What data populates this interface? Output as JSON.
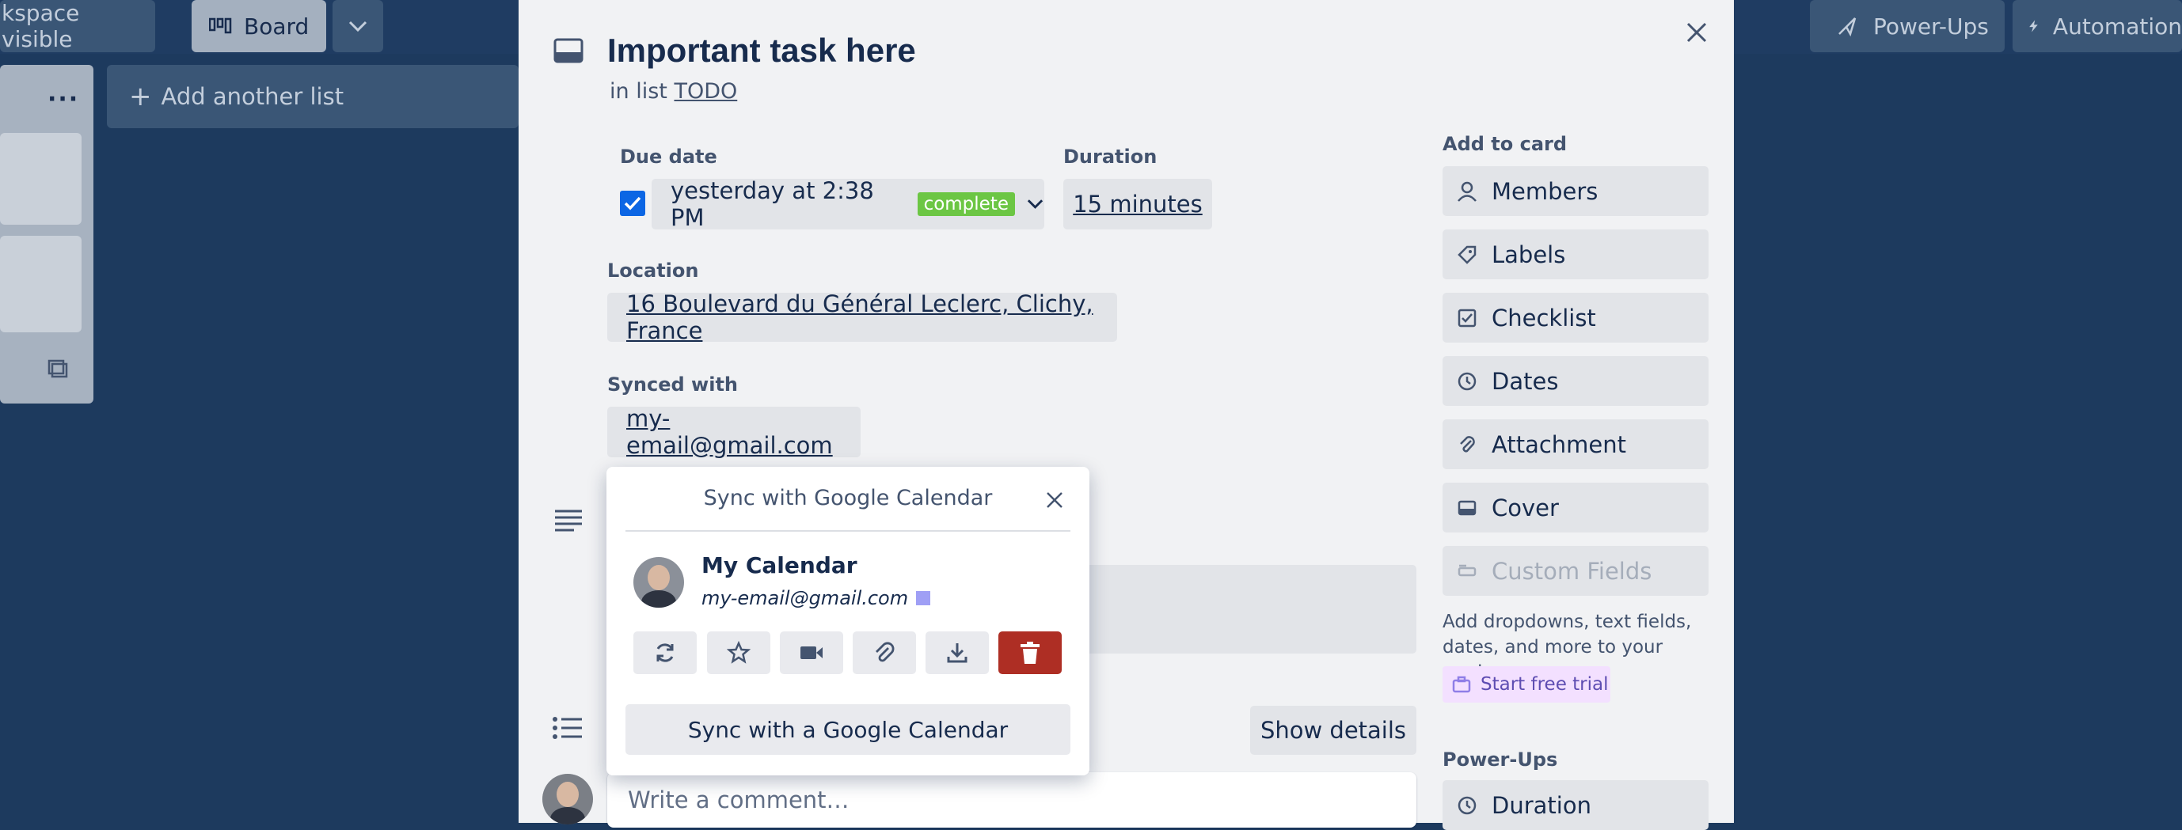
{
  "board": {
    "visibility_label": "kspace visible",
    "view_label": "Board",
    "powerups_label": "Power-Ups",
    "automation_label": "Automation",
    "add_list_label": "Add another list"
  },
  "card": {
    "title": "Important task here",
    "in_list_prefix": "in list",
    "list_name": "TODO",
    "due_date": {
      "label": "Due date",
      "value": "yesterday at 2:38 PM",
      "badge": "complete",
      "checked": true
    },
    "duration": {
      "label": "Duration",
      "value": "15 minutes"
    },
    "location": {
      "label": "Location",
      "value": "16 Boulevard du Général Leclerc, Clichy, France"
    },
    "synced": {
      "label": "Synced with",
      "value": "my-email@gmail.com"
    },
    "show_details_label": "Show details",
    "comment_placeholder": "Write a comment…"
  },
  "sidebar": {
    "add_to_card_label": "Add to card",
    "items": [
      {
        "label": "Members",
        "icon": "person-icon"
      },
      {
        "label": "Labels",
        "icon": "tag-icon"
      },
      {
        "label": "Checklist",
        "icon": "checklist-icon"
      },
      {
        "label": "Dates",
        "icon": "clock-icon"
      },
      {
        "label": "Attachment",
        "icon": "paperclip-icon"
      },
      {
        "label": "Cover",
        "icon": "cover-icon"
      },
      {
        "label": "Custom Fields",
        "icon": "custom-fields-icon",
        "disabled": true
      }
    ],
    "custom_fields_hint": "Add dropdowns, text fields, dates, and more to your cards.",
    "trial_label": "Start free trial",
    "powerups_label": "Power-Ups",
    "powerups_items": [
      {
        "label": "Duration",
        "icon": "clock-icon"
      }
    ]
  },
  "popover": {
    "title": "Sync with Google Calendar",
    "calendar_name": "My Calendar",
    "calendar_email": "my-email@gmail.com",
    "calendar_color": "#9f9ff5",
    "action_icons": [
      "refresh-icon",
      "star-icon",
      "video-icon",
      "paperclip-icon",
      "download-icon",
      "trash-icon"
    ],
    "sync_button_label": "Sync with a Google Calendar"
  },
  "colors": {
    "board_bg": "#1d3a5e",
    "modal_bg": "#f1f2f4",
    "complete_badge": "#4bce97",
    "checkbox": "#0c66e4",
    "danger": "#ae2e24",
    "trial_bg": "#f3e0ff"
  }
}
